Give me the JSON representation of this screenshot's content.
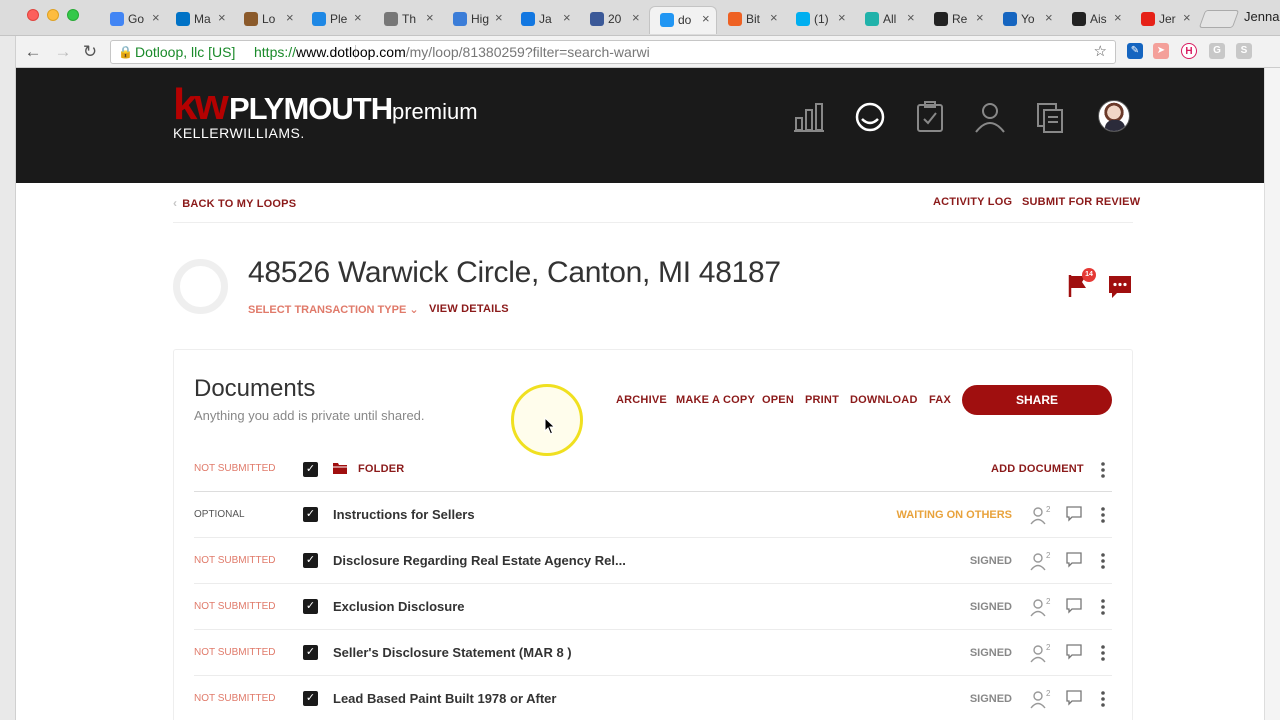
{
  "browser": {
    "tabs": [
      {
        "label": "Go",
        "icon": "google-icon",
        "color": "#4285f4"
      },
      {
        "label": "Ma",
        "icon": "outlook-icon",
        "color": "#0072c6"
      },
      {
        "label": "Lo",
        "icon": "person-icon",
        "color": "#8b5a2b"
      },
      {
        "label": "Ple",
        "icon": "vee-icon",
        "color": "#1e88e5"
      },
      {
        "label": "Th",
        "icon": "globe-icon",
        "color": "#777777"
      },
      {
        "label": "Hig",
        "icon": "cloud-icon",
        "color": "#3b7dd8"
      },
      {
        "label": "Ja",
        "icon": "zillow-icon",
        "color": "#1277e1"
      },
      {
        "label": "20",
        "icon": "facebook-icon",
        "color": "#3b5998"
      },
      {
        "label": "do",
        "icon": "dotloop-icon",
        "color": "#2196f3"
      },
      {
        "label": "Bit",
        "icon": "bitly-icon",
        "color": "#ee6123"
      },
      {
        "label": "(1)",
        "icon": "skype-icon",
        "color": "#00aff0"
      },
      {
        "label": "All",
        "icon": "c-icon",
        "color": "#20b2aa"
      },
      {
        "label": "Re",
        "icon": "is-icon",
        "color": "#222222"
      },
      {
        "label": "Yo",
        "icon": "speaker-icon",
        "color": "#1565c0"
      },
      {
        "label": "Ais",
        "icon": "wordpress-icon",
        "color": "#222222"
      },
      {
        "label": "Jer",
        "icon": "youtube-icon",
        "color": "#e62117"
      }
    ],
    "active_tab": 8,
    "profile_name": "Jenna",
    "cert_label": "Dotloop, llc [US]",
    "url_scheme": "https://",
    "url_host": "www.dotloop.com",
    "url_path": "/my/loop/81380259?filter=search-warwi"
  },
  "header": {
    "logo_kw": "kw",
    "logo_city": "PLYMOUTH",
    "logo_brand": "KELLERWILLIAMS.",
    "tier": "premium",
    "icons": [
      "chart-icon",
      "loop-icon",
      "tasks-icon",
      "person-icon",
      "templates-icon"
    ],
    "active_icon": "loop-icon"
  },
  "loop": {
    "back_label": "BACK TO MY LOOPS",
    "activity_label": "ACTIVITY LOG",
    "submit_label": "SUBMIT FOR REVIEW",
    "address": "48526 Warwick Circle, Canton, MI 48187",
    "transaction_type": "SELECT TRANSACTION TYPE",
    "view_details": "VIEW DETAILS",
    "flag_count": "14"
  },
  "documents": {
    "title": "Documents",
    "subtitle": "Anything you add is private until shared.",
    "actions": [
      "ARCHIVE",
      "MAKE A COPY",
      "OPEN",
      "PRINT",
      "DOWNLOAD",
      "FAX"
    ],
    "share_label": "SHARE",
    "folder": {
      "status": "NOT SUBMITTED",
      "label": "FOLDER",
      "add_label": "ADD DOCUMENT"
    },
    "rows": [
      {
        "status": "OPTIONAL",
        "name": "Instructions for Sellers",
        "state": "WAITING ON OTHERS",
        "participants": "2"
      },
      {
        "status": "NOT SUBMITTED",
        "name": "Disclosure Regarding Real Estate Agency Rel...",
        "state": "SIGNED",
        "participants": "2"
      },
      {
        "status": "NOT SUBMITTED",
        "name": "Exclusion Disclosure",
        "state": "SIGNED",
        "participants": "2"
      },
      {
        "status": "NOT SUBMITTED",
        "name": "Seller's Disclosure Statement (MAR 8 )",
        "state": "SIGNED",
        "participants": "2"
      },
      {
        "status": "NOT SUBMITTED",
        "name": "Lead Based Paint Built 1978 or After",
        "state": "SIGNED",
        "participants": "2"
      }
    ]
  },
  "colors": {
    "brand_red": "#a00f0f",
    "header_bg": "#1a1a1a",
    "link_red": "#8b1a1a",
    "status_salmon": "#e07a6a",
    "waiting_orange": "#e8a23b"
  }
}
